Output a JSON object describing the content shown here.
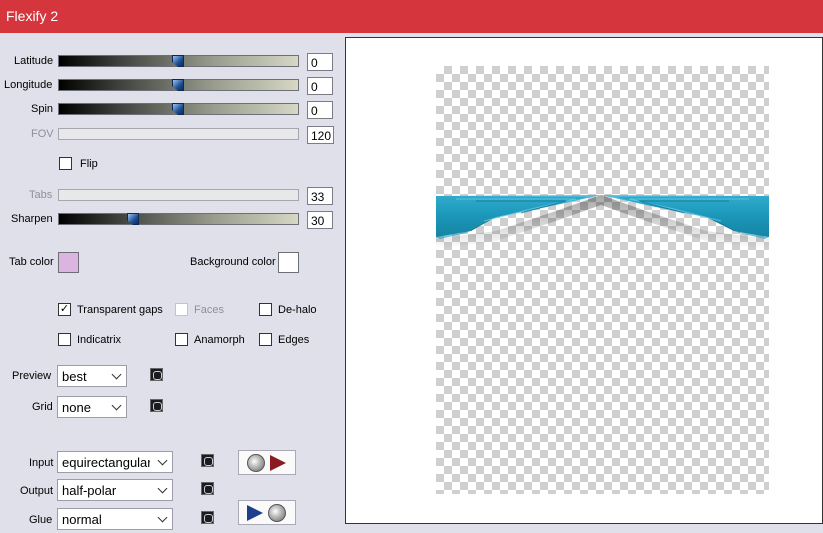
{
  "window": {
    "title": "Flexify 2"
  },
  "sliders": [
    {
      "label": "Latitude",
      "value": "0",
      "position": 0.5,
      "enabled": true
    },
    {
      "label": "Longitude",
      "value": "0",
      "position": 0.5,
      "enabled": true
    },
    {
      "label": "Spin",
      "value": "0",
      "position": 0.5,
      "enabled": true
    },
    {
      "label": "FOV",
      "value": "120",
      "enabled": false
    },
    {
      "label": "Tabs",
      "value": "33",
      "enabled": false
    },
    {
      "label": "Sharpen",
      "value": "30",
      "position": 0.3,
      "enabled": true
    }
  ],
  "flip": {
    "label": "Flip",
    "checked": false
  },
  "colors": {
    "tab_color_label": "Tab color",
    "tab_color": "#dbb4e0",
    "background_color_label": "Background color",
    "background_color": "#ffffff"
  },
  "options": {
    "transparent_gaps": {
      "label": "Transparent gaps",
      "checked": true,
      "mark": "✓"
    },
    "faces": {
      "label": "Faces",
      "checked": false,
      "enabled": false
    },
    "de_halo": {
      "label": "De-halo",
      "checked": false
    },
    "indicatrix": {
      "label": "Indicatrix",
      "checked": false
    },
    "anamorph": {
      "label": "Anamorph",
      "checked": false
    },
    "edges": {
      "label": "Edges",
      "checked": false
    }
  },
  "preview": {
    "label": "Preview",
    "value": "best"
  },
  "grid": {
    "label": "Grid",
    "value": "none"
  },
  "input": {
    "label": "Input",
    "value": "equirectangular"
  },
  "output": {
    "label": "Output",
    "value": "half-polar"
  },
  "glue": {
    "label": "Glue",
    "value": "normal"
  },
  "accent_color": "#d5353d",
  "curtain_color": "#1a8fb0"
}
